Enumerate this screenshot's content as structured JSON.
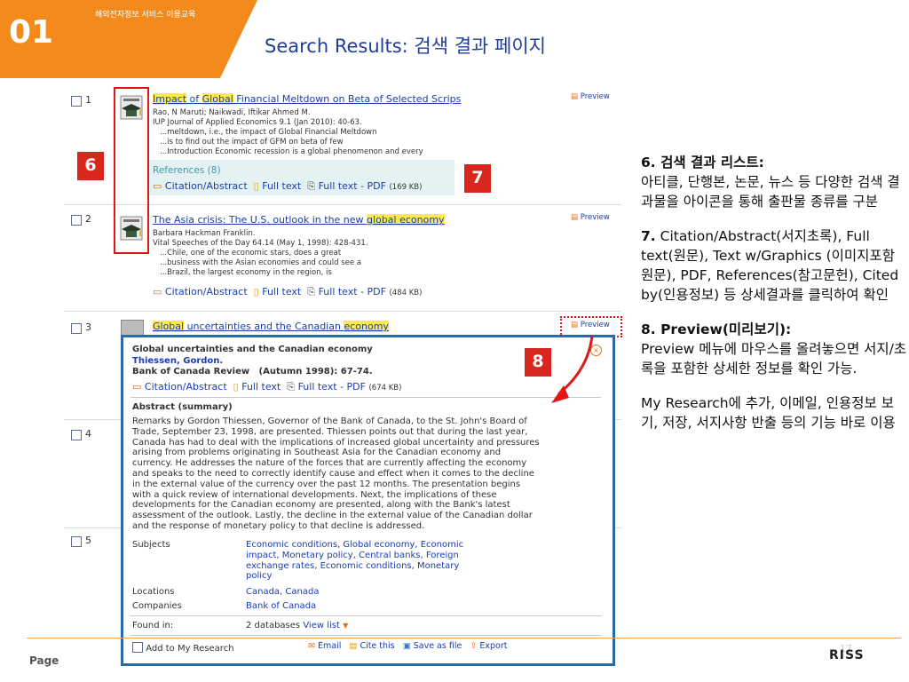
{
  "header": {
    "slide_number": "01",
    "subtitle": "해외전자정보 서비스 이용교육",
    "title": "Search Results: 검색 결과 페이지"
  },
  "results": [
    {
      "number": "1",
      "title_parts": [
        "Impact",
        " of ",
        "Global",
        " Financial Meltdown on Beta of Selected Scrips"
      ],
      "meta": [
        "Rao, N Maruti; Naikwadi, Iftikar Ahmed M.",
        "IUP Journal of Applied Economics 9.1 (Jan 2010): 40-63.",
        "...meltdown, i.e., the impact of Global Financial Meltdown",
        "...is to find out the impact of GFM on beta of few",
        "...Introduction Economic recession is a global phenomenon and every"
      ],
      "references": "References (8)",
      "citation": "Citation/Abstract",
      "fulltext": "Full text",
      "pdf": "Full text - PDF",
      "pdf_size": "(169 KB)",
      "preview": "Preview"
    },
    {
      "number": "2",
      "title_parts": [
        "The Asia crisis: The U.S. outlook in the new ",
        "global economy",
        "",
        ""
      ],
      "meta": [
        "Barbara Hackman Franklin.",
        "Vital Speeches of the Day 64.14 (May 1, 1998): 428-431.",
        "...Chile, one of the economic stars, does a great",
        "...business with the Asian economies and could see a",
        "...Brazil, the largest economy in the region, is"
      ],
      "citation": "Citation/Abstract",
      "fulltext": "Full text",
      "pdf": "Full text - PDF",
      "pdf_size": "(484 KB)",
      "preview": "Preview"
    },
    {
      "number": "3",
      "title_parts": [
        "Global",
        " uncertainties and the Canadian ",
        "economy",
        ""
      ],
      "preview": "Preview"
    },
    {
      "number": "4"
    },
    {
      "number": "5"
    }
  ],
  "badges": {
    "b6": "6",
    "b7": "7",
    "b8": "8"
  },
  "popup": {
    "title": "Global uncertainties and the Canadian economy",
    "author": "Thiessen, Gordon.",
    "source": "Bank of Canada Review   (Autumn 1998): 67-74.",
    "citation": "Citation/Abstract",
    "fulltext": "Full text",
    "pdf": "Full text - PDF",
    "pdf_size": "(674 KB)",
    "abstract_heading": "Abstract (summary)",
    "abstract_lines": [
      "Remarks by Gordon Thiessen, Governor of the Bank of Canada, to the St. John's Board of",
      "Trade, September 23, 1998, are presented. Thiessen points out that during the last year,",
      "Canada has had to deal with the implications of increased global uncertainty and pressures",
      "arising from problems originating in Southeast Asia for the Canadian economy and",
      "currency. He addresses the nature of the forces that are currently affecting the economy",
      "and speaks to the need to correctly identify cause and effect when it comes to the decline",
      "in the external value of the currency over the past 12 months. The presentation begins",
      "with a quick review of international developments. Next, the implications of these",
      "developments for the Canadian economy are presented, along with the Bank's latest",
      "assessment of the outlook. Lastly, the decline in the external value of the Canadian dollar",
      "and the response of monetary policy to that decline is addressed."
    ],
    "subjects_label": "Subjects",
    "subjects_lines": [
      "Economic conditions, Global economy, Economic",
      "impact, Monetary policy, Central banks, Foreign",
      "exchange rates, Economic conditions, Monetary",
      "policy"
    ],
    "locations_label": "Locations",
    "locations": "Canada, Canada",
    "companies_label": "Companies",
    "companies": "Bank of Canada",
    "found_label": "Found in:",
    "found_value": "2 databases",
    "view_list": "View list",
    "add_label": "Add to My Research",
    "email": "Email",
    "cite": "Cite this",
    "save": "Save as file",
    "export": "Export"
  },
  "side_text": {
    "s6_heading": "6. 검색 결과 리스트:",
    "s6_body": "아티클, 단행본, 논문, 뉴스 등 다양한 검색 결과물을 아이콘을 통해 출판물 종류를 구분",
    "s7_num": "7.",
    "s7_body": "Citation/Abstract(서지초록), Full text(원문), Text w/Graphics (이미지포함 원문), PDF, References(참고문헌), Cited by(인용정보) 등 상세결과를 클릭하여 확인",
    "s8_heading": "8. Preview(미리보기):",
    "s8_body": "Preview 메뉴에 마우스를 올려놓으면 서지/초록을 포함한 상세한 정보를 확인 가능.",
    "s9_body": "My Research에 추가, 이메일, 인용정보 보기, 저장, 서지사항 반출 등의 기능 바로 이용"
  },
  "footer": {
    "page_label": "Page",
    "page_number": "17",
    "logo": "RISS"
  }
}
